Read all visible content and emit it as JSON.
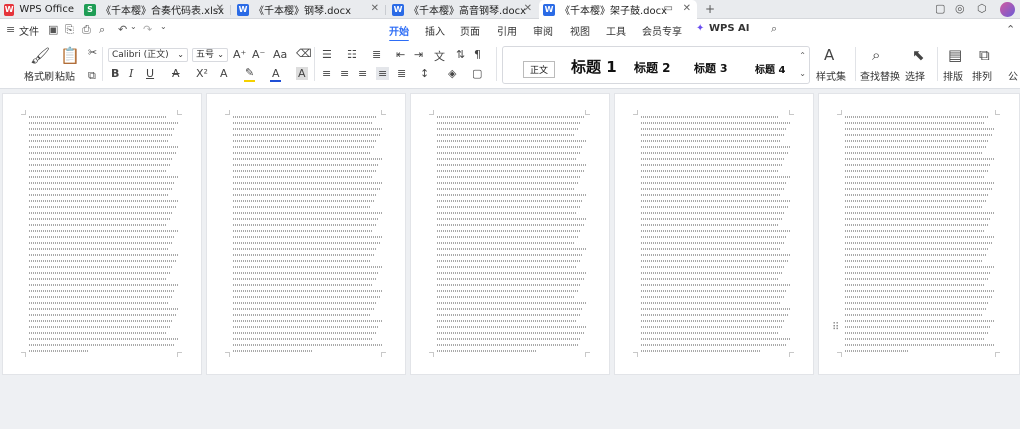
{
  "tabs": [
    {
      "label": "WPS Office",
      "icon": "wps-logo-icon",
      "color": "#e5343b",
      "glyph": "W"
    },
    {
      "label": "《千本樱》合奏代码表.xlsx",
      "icon": "spreadsheet-file-icon",
      "color": "#1f9d55",
      "glyph": "S"
    },
    {
      "label": "《千本樱》钢琴.docx",
      "icon": "document-file-icon",
      "color": "#2b6be6",
      "glyph": "W"
    },
    {
      "label": "《千本樱》高音钢琴.docx",
      "icon": "document-file-icon",
      "color": "#2b6be6",
      "glyph": "W"
    },
    {
      "label": "《千本樱》架子鼓.docx",
      "icon": "document-file-icon",
      "color": "#2b6be6",
      "glyph": "W"
    }
  ],
  "menu": {
    "file": "文件",
    "items": [
      "开始",
      "插入",
      "页面",
      "引用",
      "审阅",
      "视图",
      "工具",
      "会员专享"
    ],
    "active": "开始",
    "ai": "WPS AI"
  },
  "toolbar": {
    "format_painter": "格式刷",
    "paste": "粘贴",
    "font_name": "Calibri (正文)",
    "font_size": "五号",
    "styles": [
      "正文",
      "标题 1",
      "标题 2",
      "标题 3",
      "标题 4"
    ],
    "style_set": "样式集",
    "find_replace": "查找替换",
    "select": "选择",
    "layout": "排版",
    "arrange": "排列",
    "formula": "公"
  },
  "colors": {
    "accent": "#2d6df6",
    "font_color_bar": "#1f4fd6",
    "highlight_bar": "#f5d100"
  }
}
